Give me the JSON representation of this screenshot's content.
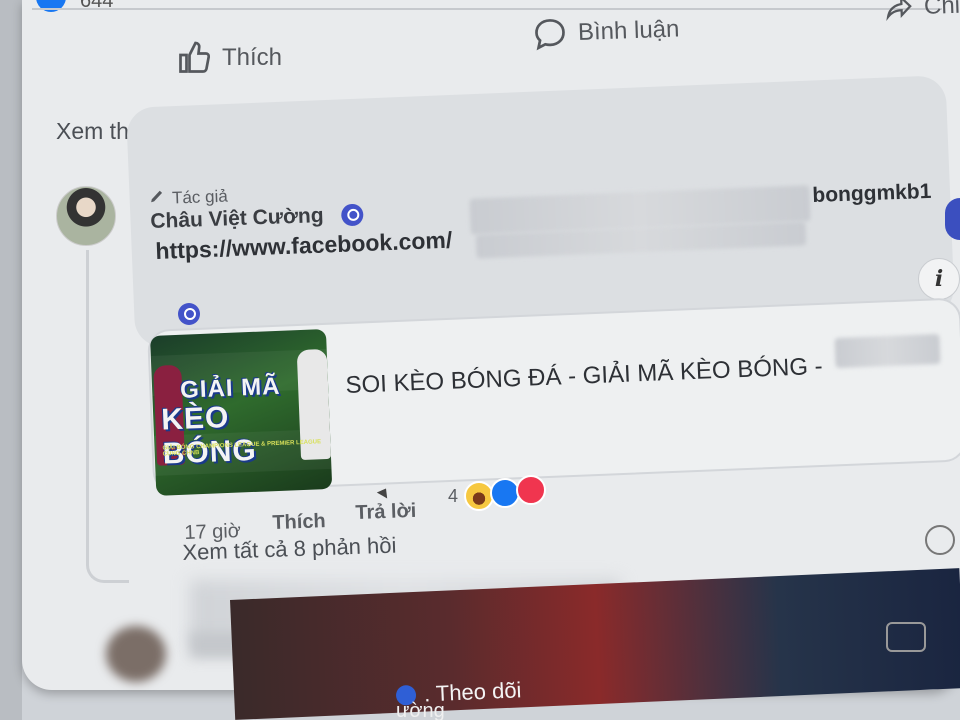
{
  "post_actions": {
    "like_label": "Thích",
    "comment_label": "Bình luận",
    "share_label": "Chi",
    "count_label": "644"
  },
  "more_comments_label": "Xem thêm bình luận",
  "comment": {
    "author_badge_label": "Tác giả",
    "author_name": "Châu Việt Cường",
    "url_prefix": "https://www.facebook.com/",
    "url_suffix": "bonggmkb1",
    "link_preview": {
      "thumb_line1": "GIẢI MÃ",
      "thumb_line2": "KÈO BÓNG",
      "thumb_sub": "GIẢI BÓNG CHAMPIONS LEAGUE & PREMIER LEAGUE CÙNG CHNB",
      "title": "SOI KÈO BÓNG ĐÁ - GIẢI MÃ KÈO BÓNG -"
    },
    "meta": {
      "time": "17 giờ",
      "like": "Thích",
      "reply": "Trả lời",
      "reaction_count": "4"
    },
    "view_replies": "Xem tất cả 8 phản hồi"
  },
  "next_post": {
    "follow_label": ". Theo dõi",
    "name_fragment": "ường"
  },
  "icons": {
    "like": "thumbs-up-icon",
    "comment": "speech-bubble-icon",
    "share": "share-arrow-icon",
    "info": "info-icon",
    "emoji": "emoji-icon",
    "camera": "camera-icon",
    "verified": "verified-badge-icon",
    "pen": "pen-icon"
  },
  "colors": {
    "facebook_blue": "#1877f2",
    "verified_badge": "#4353c9",
    "love_red": "#f0354f"
  }
}
